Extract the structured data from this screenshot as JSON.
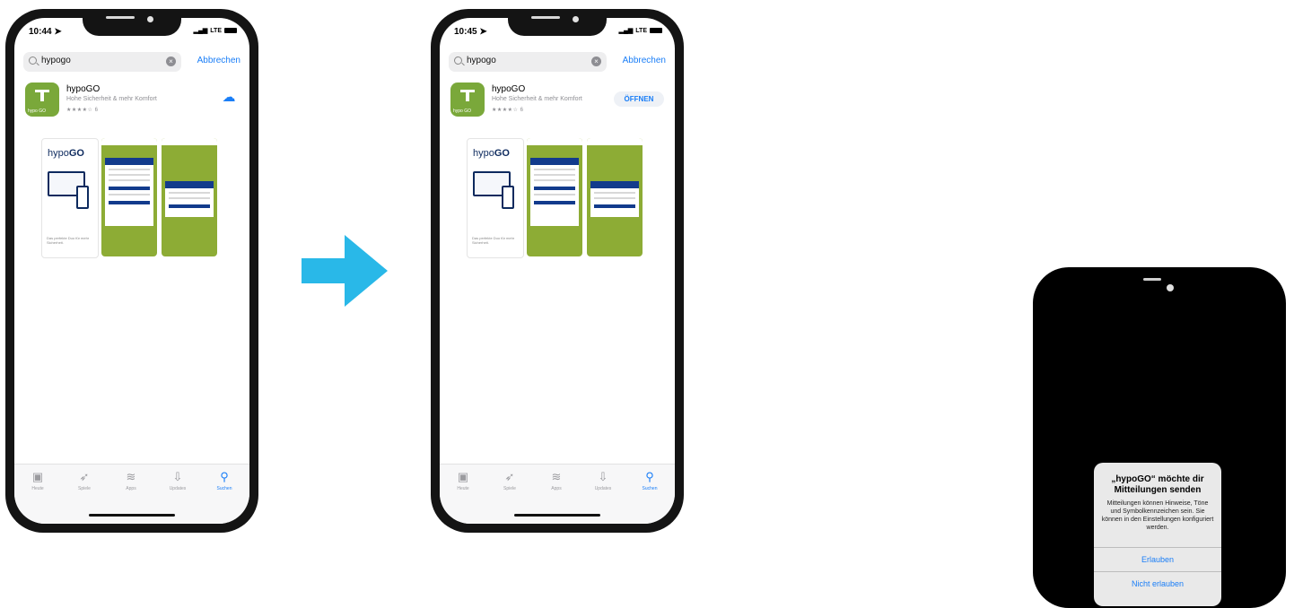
{
  "phone1": {
    "status": {
      "time": "10:44 ➤",
      "network": "LTE"
    },
    "search": {
      "query": "hypogo",
      "cancel": "Abbrechen"
    },
    "result": {
      "name": "hypoGO",
      "subtitle": "Hohe Sicherheit & mehr Komfort",
      "rating": "★★★★☆",
      "rating_count": "6",
      "action": "cloud-download",
      "icon_label": "hypo GO"
    },
    "screenshot1": {
      "brand_a": "hypo",
      "brand_b": "GO",
      "caption": "Das perfekte Duo für mehr Sicherheit."
    },
    "tabs": [
      {
        "label": "Heute",
        "icon": "today-icon"
      },
      {
        "label": "Spiele",
        "icon": "rocket-icon"
      },
      {
        "label": "Apps",
        "icon": "stack-icon"
      },
      {
        "label": "Updates",
        "icon": "download-tray-icon"
      },
      {
        "label": "Suchen",
        "icon": "search-icon",
        "active": true
      }
    ]
  },
  "phone2": {
    "status": {
      "time": "10:45 ➤",
      "network": "LTE"
    },
    "search": {
      "query": "hypogo",
      "cancel": "Abbrechen"
    },
    "result": {
      "name": "hypoGO",
      "subtitle": "Hohe Sicherheit & mehr Komfort",
      "rating": "★★★★☆",
      "rating_count": "6",
      "action_label": "ÖFFNEN",
      "icon_label": "hypo GO"
    },
    "screenshot1": {
      "brand_a": "hypo",
      "brand_b": "GO",
      "caption": "Das perfekte Duo für mehr Sicherheit."
    },
    "tabs": [
      {
        "label": "Heute",
        "icon": "today-icon"
      },
      {
        "label": "Spiele",
        "icon": "rocket-icon"
      },
      {
        "label": "Apps",
        "icon": "stack-icon"
      },
      {
        "label": "Updates",
        "icon": "download-tray-icon"
      },
      {
        "label": "Suchen",
        "icon": "search-icon",
        "active": true
      }
    ]
  },
  "arrow": {
    "color": "#29b8e8"
  },
  "phone3": {
    "alert": {
      "title": "„hypoGO“ möchte dir Mitteilungen senden",
      "body": "Mitteilungen können Hinweise, Töne und Symbolkennzeichen sein. Sie können in den Einstellungen konfiguriert werden.",
      "allow": "Erlauben",
      "deny": "Nicht erlauben"
    }
  },
  "colors": {
    "accent": "#1a7ef7",
    "brand_green": "#8dac35",
    "brand_navy": "#0d2a5e"
  }
}
